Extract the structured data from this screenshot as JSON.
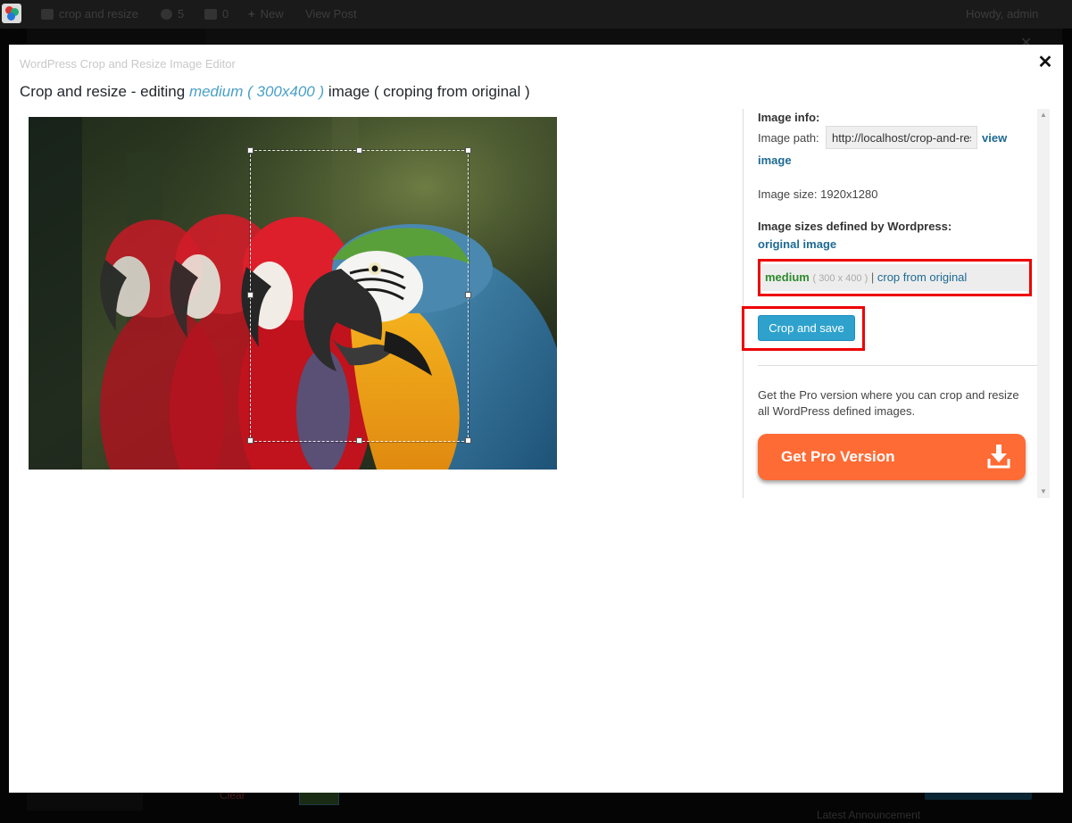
{
  "admin_bar": {
    "site_name": "crop and resize",
    "updates_count": "5",
    "comments_count": "0",
    "new_label": "New",
    "view_post_label": "View Post",
    "howdy": "Howdy, admin"
  },
  "background": {
    "clear_label": "Clear",
    "footer_text": "Latest Announcement"
  },
  "modal": {
    "label": "WordPress Crop and Resize Image Editor",
    "close_glyph": "✕",
    "heading": {
      "prefix": "Crop and resize - editing ",
      "size": "medium ( 300x400 )",
      "suffix": " image ( croping from original )"
    }
  },
  "sidebar": {
    "image_info_title": "Image info:",
    "image_path_label": "Image path:",
    "image_path_value": "http://localhost/crop-and-resize/wp-content/uploads/parrots.jpg",
    "view_label": "view",
    "image_label": "image",
    "image_size": "Image size: 1920x1280",
    "defined_title": "Image sizes defined by Wordpress:",
    "original_image_label": "original image",
    "medium": {
      "name": "medium",
      "dims": "( 300 x 400 )",
      "separator": "|",
      "crop_label": "crop from original"
    },
    "crop_save_label": "Crop and save",
    "pro_text": "Get the Pro version where you can crop and resize all WordPress defined images.",
    "pro_button_label": "Get Pro Version"
  },
  "colors": {
    "accent": "#2ea2cc",
    "pro_button": "#ff6b35",
    "highlight_box": "#ee0000",
    "medium_green": "#2e8b2e",
    "link": "#1e6a93"
  },
  "icons": {
    "close": "close-icon",
    "download": "download-icon",
    "wordpress": "wordpress-logo-icon"
  }
}
